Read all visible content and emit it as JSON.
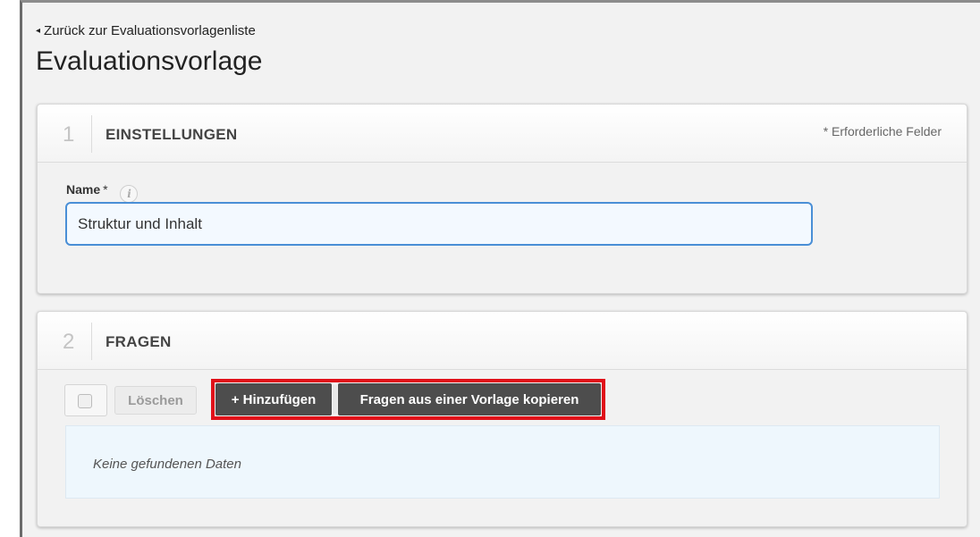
{
  "nav": {
    "back_label": "Zurück zur Evaluationsvorlagenliste"
  },
  "page": {
    "title": "Evaluationsvorlage"
  },
  "settings_panel": {
    "step": "1",
    "title": "EINSTELLUNGEN",
    "required_note": "* Erforderliche Felder",
    "name_label": "Name",
    "required_star": "*",
    "info_icon": "i",
    "name_value": "Struktur und Inhalt"
  },
  "questions_panel": {
    "step": "2",
    "title": "FRAGEN",
    "delete_label": "Löschen",
    "add_label": "+ Hinzufügen",
    "copy_label": "Fragen aus einer Vorlage kopieren",
    "empty_message": "Keine gefundenen Daten"
  },
  "colors": {
    "highlight": "#e0101a",
    "dark_button": "#4d4d4d",
    "input_border": "#4a8fd6"
  }
}
